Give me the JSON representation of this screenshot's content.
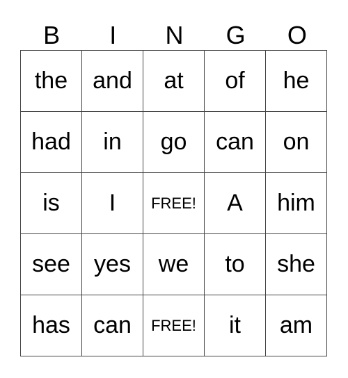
{
  "header": [
    "B",
    "I",
    "N",
    "G",
    "O"
  ],
  "rows": [
    [
      "the",
      "and",
      "at",
      "of",
      "he"
    ],
    [
      "had",
      "in",
      "go",
      "can",
      "on"
    ],
    [
      "is",
      "I",
      "FREE!",
      "A",
      "him"
    ],
    [
      "see",
      "yes",
      "we",
      "to",
      "she"
    ],
    [
      "has",
      "can",
      "FREE!",
      "it",
      "am"
    ]
  ]
}
